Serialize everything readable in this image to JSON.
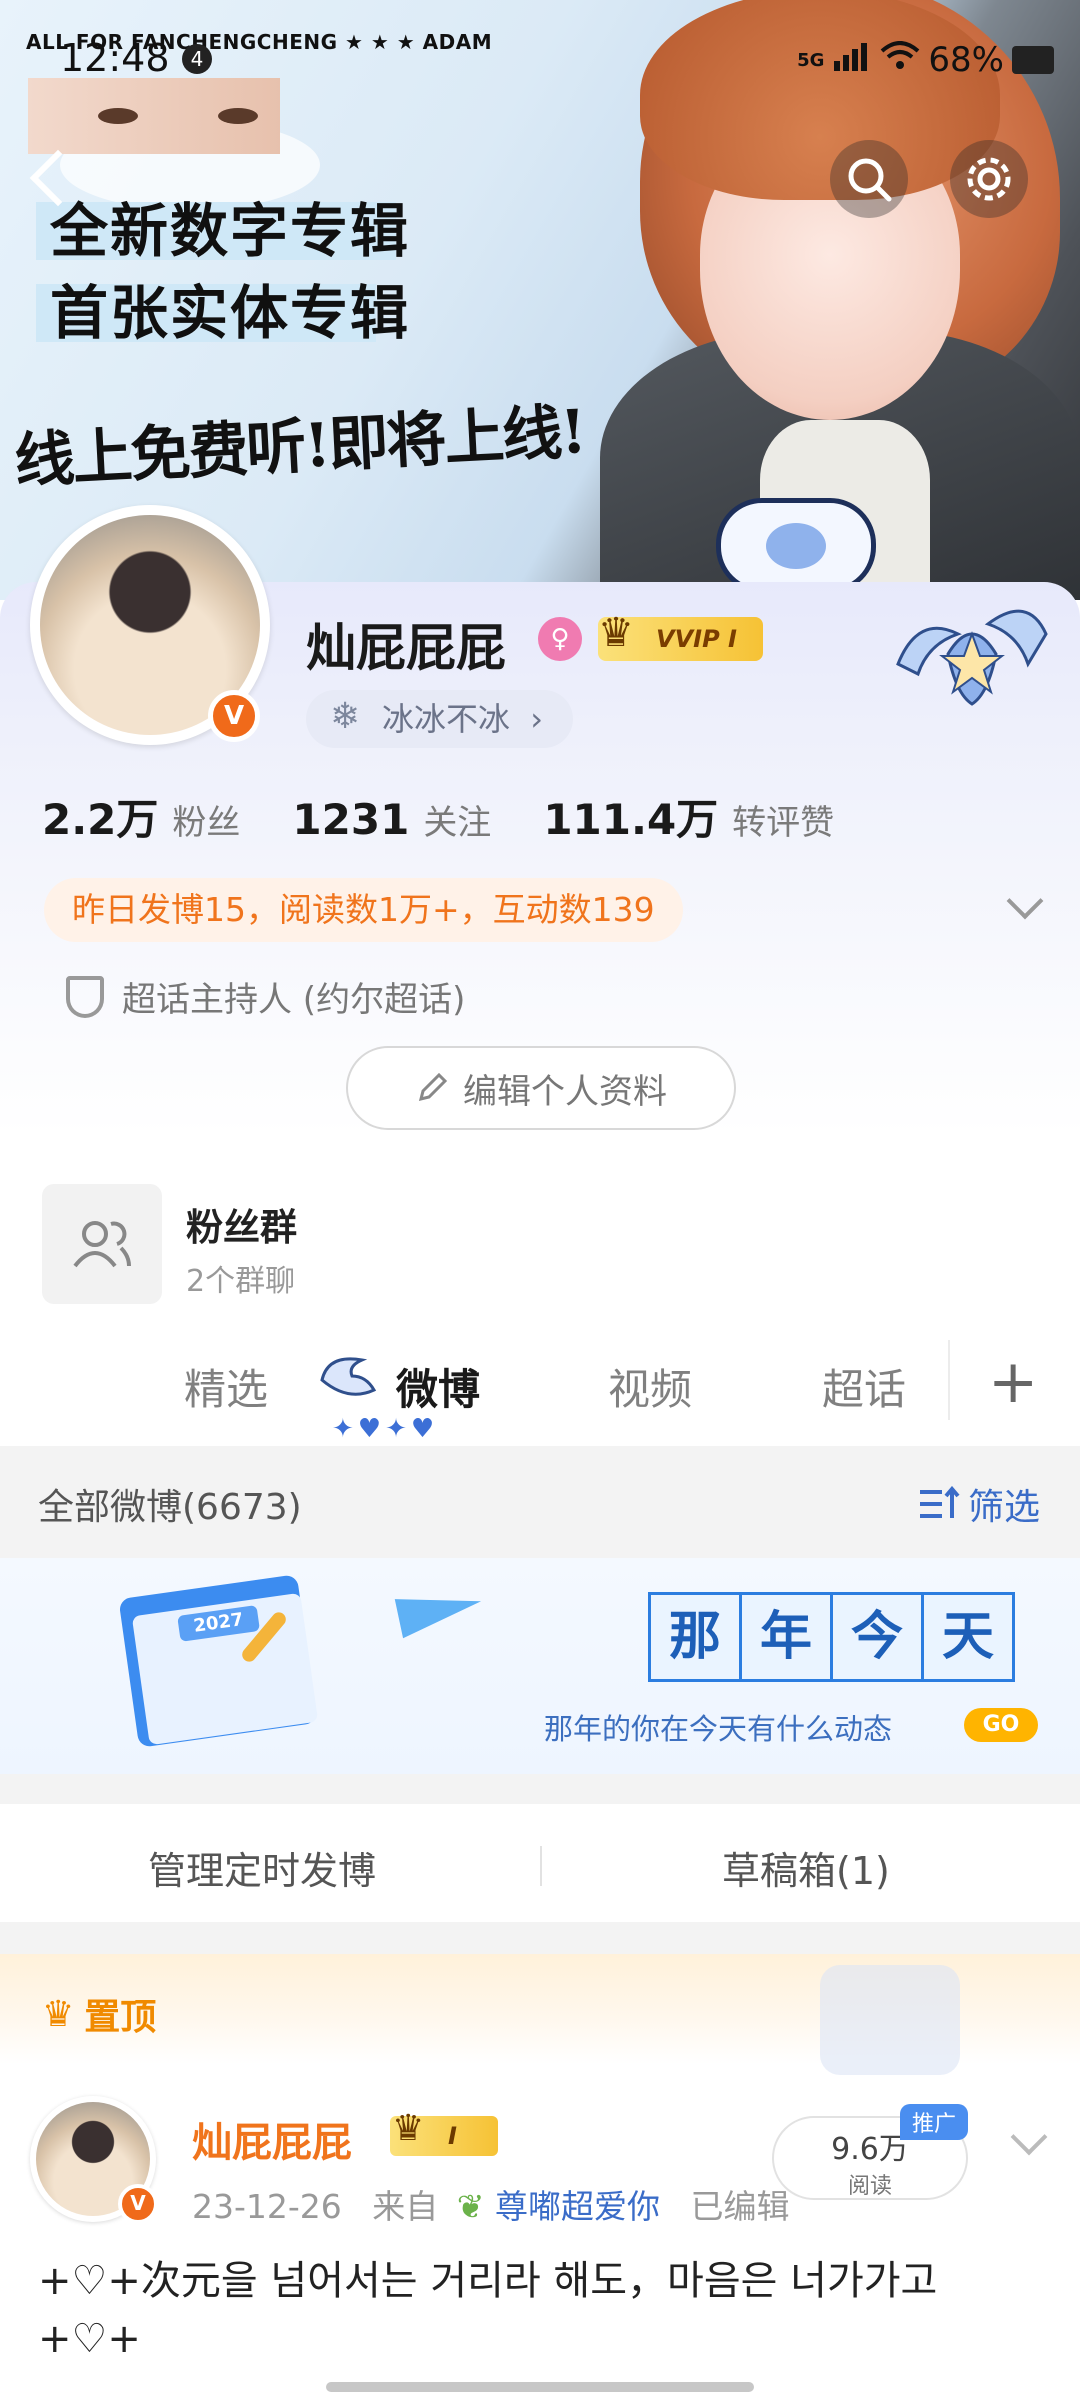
{
  "status_bar": {
    "overlay_text": "ALL FOR FANCHENGCHENG ★ ★ ★ ADAM",
    "time": "12:48",
    "notification_count": "4",
    "network": "5G",
    "battery": "68%"
  },
  "banner": {
    "line1": "全新数字专辑",
    "line2": "首张实体专辑",
    "line3": "线上免费听!即将上线!"
  },
  "profile": {
    "username": "灿屁屁屁",
    "gender_symbol": "♀",
    "vip_label": "VVIP I",
    "tag": "冰冰不冰",
    "verified_symbol": "V",
    "stats": [
      {
        "num": "2.2万",
        "label": "粉丝"
      },
      {
        "num": "1231",
        "label": "关注"
      },
      {
        "num": "111.4万",
        "label": "转评赞"
      }
    ],
    "yesterday_summary": "昨日发博15，阅读数1万+，互动数139",
    "host_role": "超话主持人 (约尔超话)",
    "edit_button": "编辑个人资料"
  },
  "fan_group": {
    "title": "粉丝群",
    "subtitle": "2个群聊"
  },
  "tabs": {
    "items": [
      "精选",
      "微博",
      "视频",
      "超话"
    ],
    "active": "微博",
    "plus": "+",
    "dots": "✦♥✦♥"
  },
  "feed_header": {
    "all_label": "全部微博(6673)",
    "filter_label": "筛选"
  },
  "year_today": {
    "title_chars": [
      "那",
      "年",
      "今",
      "天"
    ],
    "subtitle": "那年的你在今天有什么动态",
    "go": "GO",
    "calendar_year": "2027"
  },
  "manage": {
    "scheduled": "管理定时发博",
    "drafts": "草稿箱(1)"
  },
  "pinned_post": {
    "pin_label": "置顶",
    "author": "灿屁屁屁",
    "vip_label": "I",
    "date": "23-12-26",
    "from_prefix": "来自",
    "source": "尊嘟超爱你",
    "edited": "已编辑",
    "reads_num": "9.6万",
    "reads_label": "阅读",
    "promo_tag": "推广",
    "text": "+♡+次元을 넘어서는 거리라 해도，마음은 너가가고 +♡+"
  }
}
